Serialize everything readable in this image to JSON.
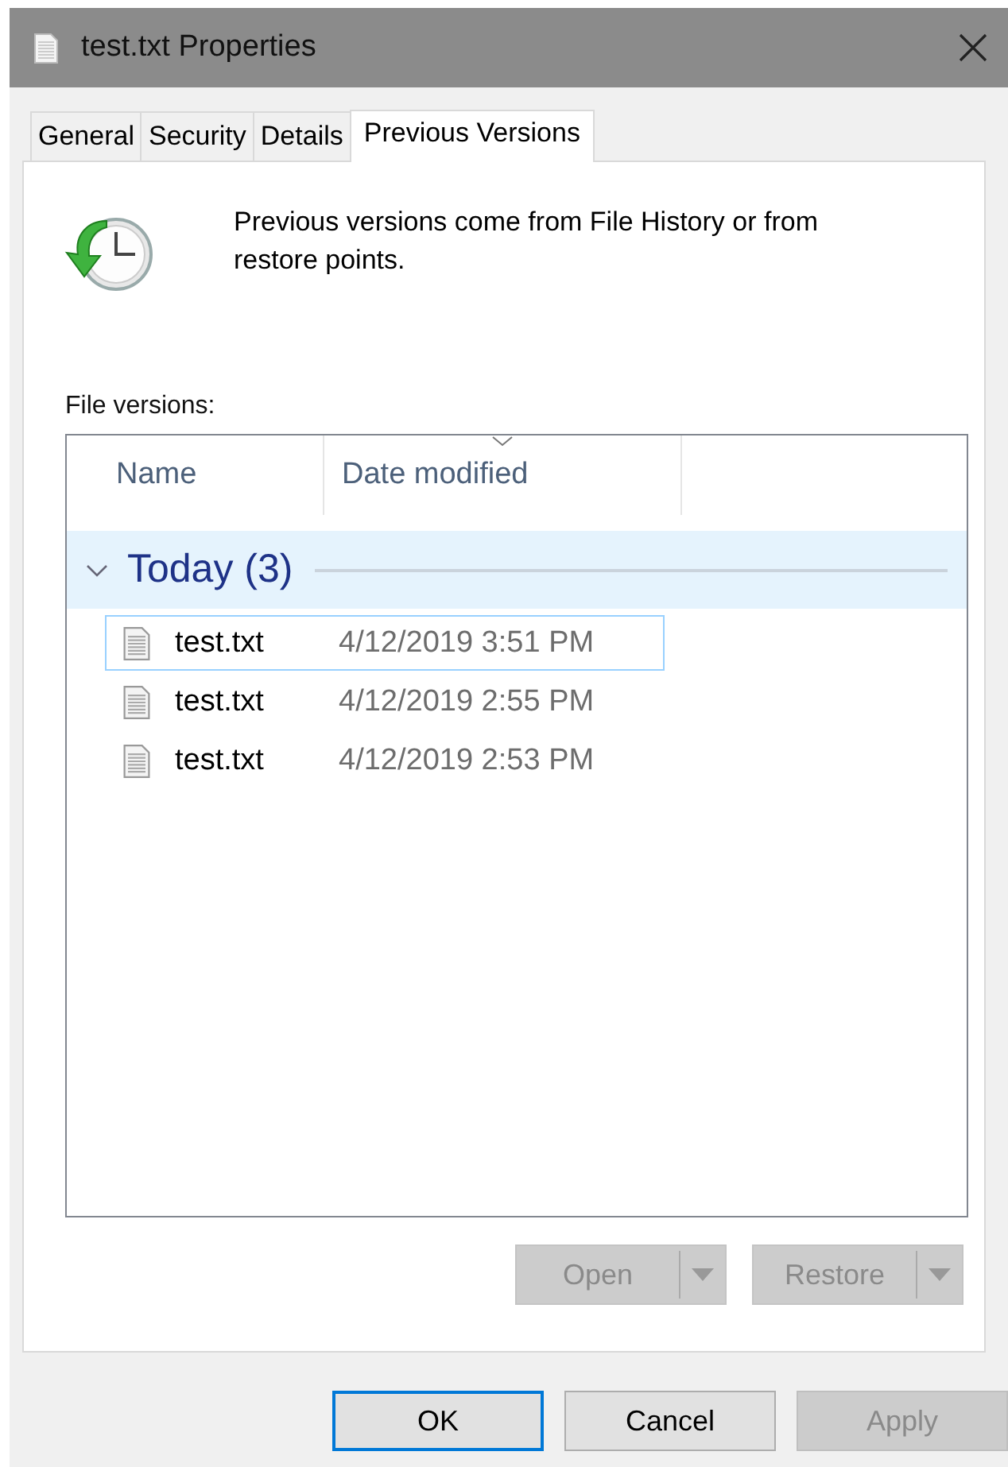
{
  "window": {
    "title": "test.txt Properties"
  },
  "tabs": [
    {
      "label": "General",
      "selected": false
    },
    {
      "label": "Security",
      "selected": false
    },
    {
      "label": "Details",
      "selected": false
    },
    {
      "label": "Previous Versions",
      "selected": true
    }
  ],
  "description": "Previous versions come from File History or from restore points.",
  "versions_label": "File versions:",
  "columns": [
    {
      "label": "Name",
      "sorted": false
    },
    {
      "label": "Date modified",
      "sorted": true
    }
  ],
  "group": {
    "label": "Today (3)",
    "expanded": true
  },
  "rows": [
    {
      "name": "test.txt",
      "date": "4/12/2019 3:51 PM",
      "selected": true
    },
    {
      "name": "test.txt",
      "date": "4/12/2019 2:55 PM",
      "selected": false
    },
    {
      "name": "test.txt",
      "date": "4/12/2019 2:53 PM",
      "selected": false
    }
  ],
  "split_buttons": [
    {
      "label": "Open",
      "disabled": true
    },
    {
      "label": "Restore",
      "disabled": true
    }
  ],
  "buttons": [
    {
      "label": "OK",
      "default": true,
      "disabled": false
    },
    {
      "label": "Cancel",
      "default": false,
      "disabled": false
    },
    {
      "label": "Apply",
      "default": false,
      "disabled": true
    }
  ]
}
